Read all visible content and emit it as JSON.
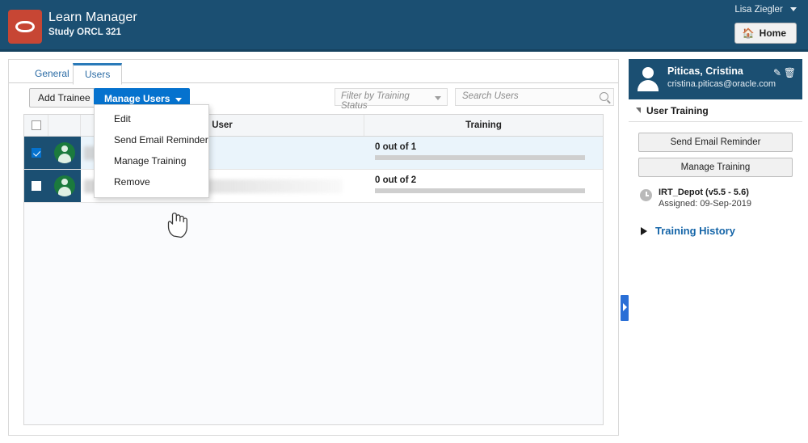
{
  "header": {
    "logo_icon": "oracle-logo",
    "app_title": "Learn Manager",
    "app_subtitle": "Study ORCL 321",
    "user_name": "Lisa Ziegler",
    "home_label": "Home",
    "home_icon": "home-icon"
  },
  "tabs": [
    {
      "label": "General",
      "active": false
    },
    {
      "label": "Users",
      "active": true
    }
  ],
  "toolbar": {
    "add_trainee_label": "Add Trainee",
    "manage_users_label": "Manage Users",
    "filter_placeholder": "Filter by Training Status",
    "search_placeholder": "Search Users",
    "search_value": ""
  },
  "dropdown": {
    "open": true,
    "items": [
      {
        "label": "Edit"
      },
      {
        "label": "Send Email Reminder"
      },
      {
        "label": "Manage Training"
      },
      {
        "label": "Remove"
      }
    ]
  },
  "table": {
    "columns": {
      "select": "",
      "avatar": "",
      "user": "User",
      "training": "Training"
    },
    "header_checkbox_checked": false,
    "rows": [
      {
        "selected": true,
        "checked": true,
        "user_name": "",
        "user_redacted": true,
        "redact_width": 130,
        "training_label": "0 out of 1",
        "progress_percent": 0
      },
      {
        "selected": false,
        "checked": false,
        "user_name": "",
        "user_redacted": true,
        "redact_width": 320,
        "training_label": "0 out of 2",
        "progress_percent": 0
      }
    ]
  },
  "slide_handle": {
    "icon": "chevron-right-icon"
  },
  "side_panel": {
    "person_name": "Piticas, Cristina",
    "person_email": "cristina.piticas@oracle.com",
    "edit_icon": "pencil-icon",
    "delete_icon": "trash-icon",
    "section_title": "User Training",
    "buttons": [
      {
        "label": "Send Email Reminder"
      },
      {
        "label": "Manage Training"
      }
    ],
    "course": {
      "icon": "clock-icon",
      "title": "IRT_Depot (v5.5 - 5.6)",
      "assigned": "Assigned: 09-Sep-2019"
    },
    "training_history_label": "Training History"
  },
  "colors": {
    "header_navy": "#1b4f72",
    "brand_red": "#c74634",
    "accent_blue": "#0572ce",
    "link_blue": "#1565a8",
    "avatar_green": "#1b7a3d",
    "selected_row": "#eaf4fb"
  }
}
